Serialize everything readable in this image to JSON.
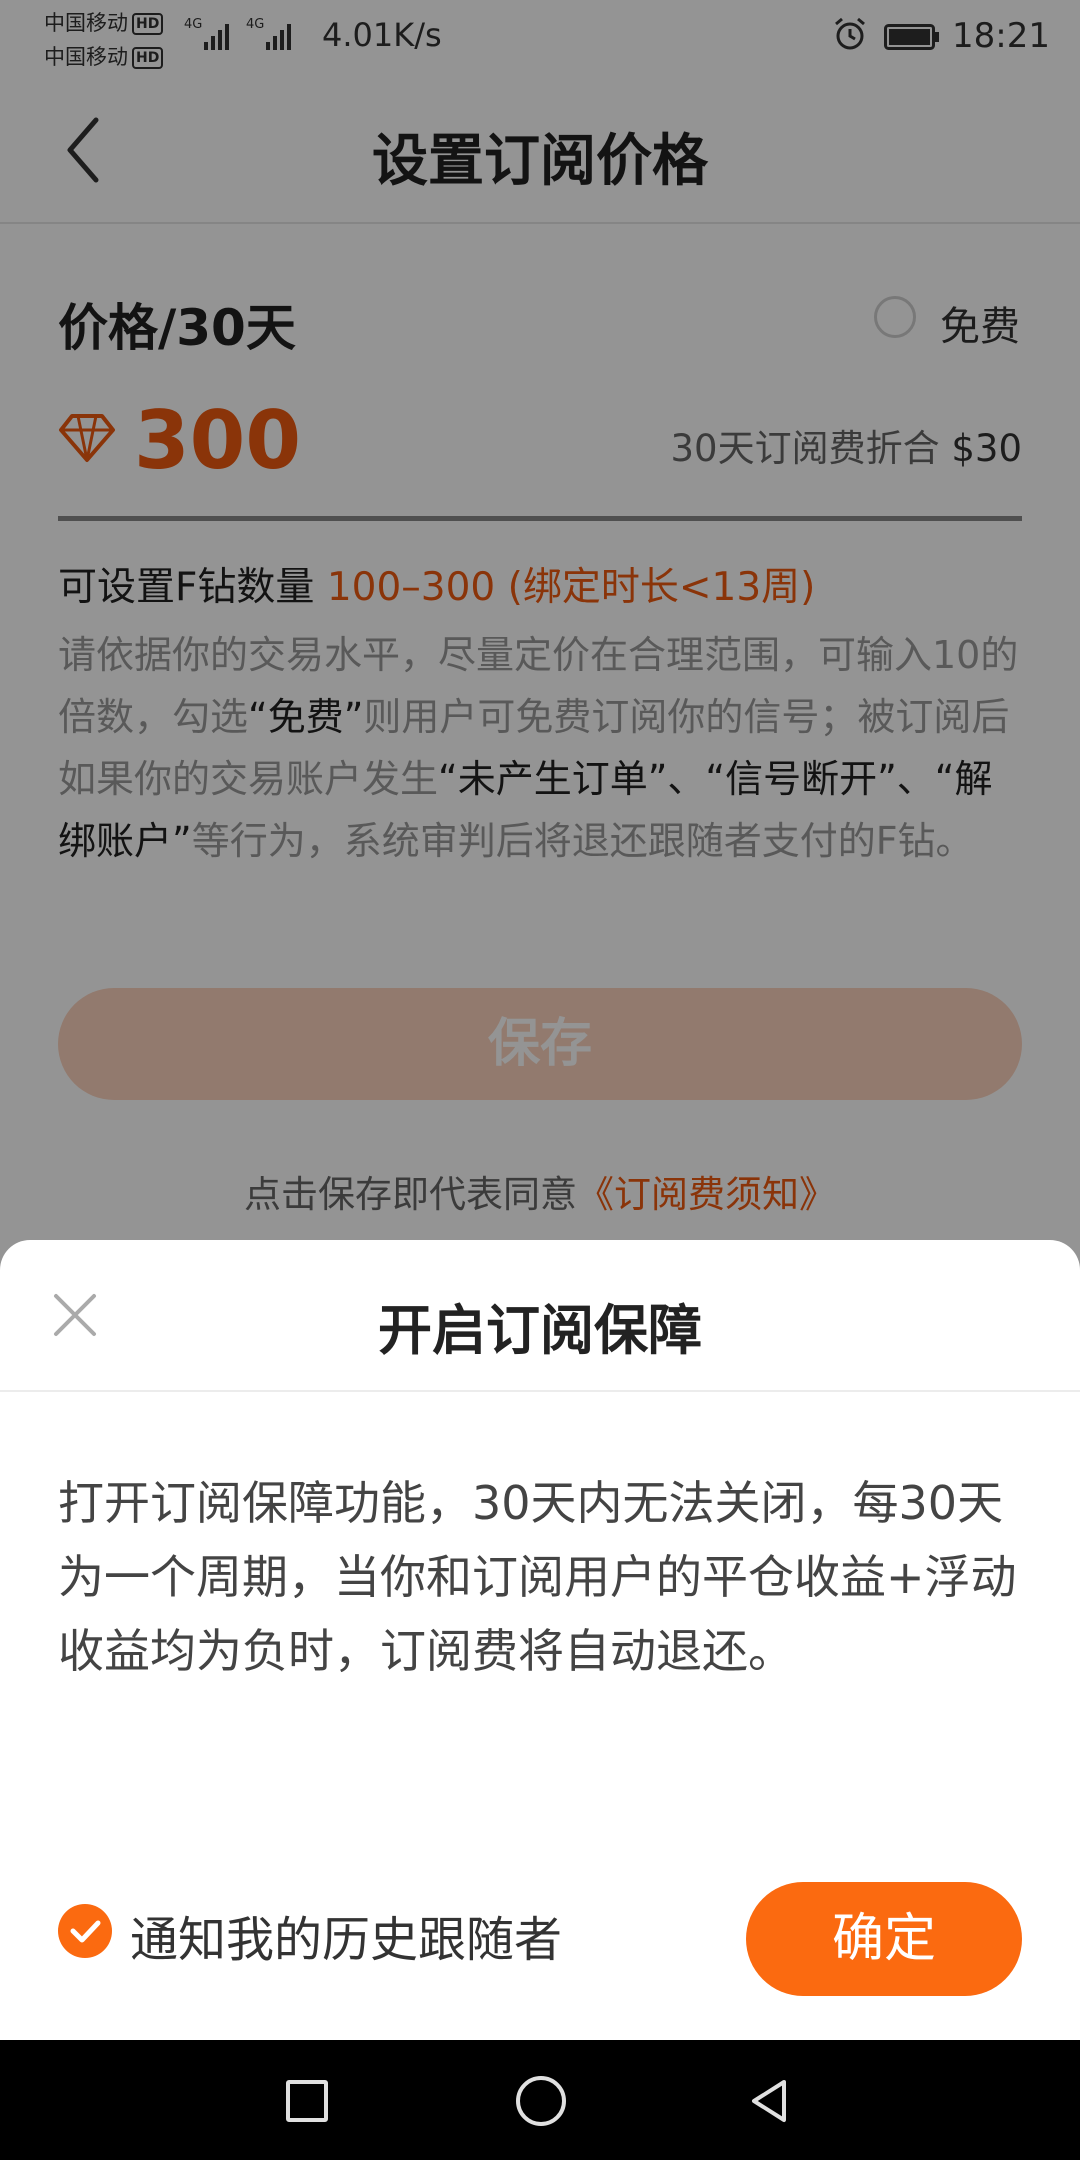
{
  "status_bar": {
    "carrier1": "中国移动",
    "carrier2": "中国移动",
    "hd": "HD",
    "network": "4G",
    "speed": "4.01K/s",
    "time": "18:21"
  },
  "header": {
    "title": "设置订阅价格",
    "back_icon": "chevron-left-icon"
  },
  "price": {
    "label": "价格/30天",
    "free_label": "免费",
    "free_checked": false,
    "value": "300",
    "equiv_prefix": "30天订阅费折合",
    "equiv_amount": "$30",
    "icon": "diamond-icon"
  },
  "range": {
    "prefix": "可设置F钻数量",
    "value": "100–300 (绑定时长<13周)"
  },
  "description": {
    "p1": "请依据你的交易水平，尽量定价在合理范围，可输入10的倍数，勾选",
    "k1": "“免费”",
    "p2": "则用户可免费订阅你的信号；被订阅后如果你的交易账户发生",
    "k2": "“未产生订单”、“信号断开”、“解绑账户”",
    "p3": "等行为，系统审判后将退还跟随者支付的F钻。"
  },
  "save_button": "保存",
  "agreement": {
    "prefix": "点击保存即代表同意",
    "link": "《订阅费须知》"
  },
  "sheet": {
    "title": "开启订阅保障",
    "body": "打开订阅保障功能，30天内无法关闭，每30天为一个周期，当你和订阅用户的平仓收益+浮动收益均为负时，订阅费将自动退还。",
    "notify_label": "通知我的历史跟随者",
    "notify_checked": true,
    "confirm": "确定"
  },
  "colors": {
    "accent": "#fb6a10",
    "price_text": "#ee5a10",
    "save_disabled": "#fcd3bd"
  }
}
